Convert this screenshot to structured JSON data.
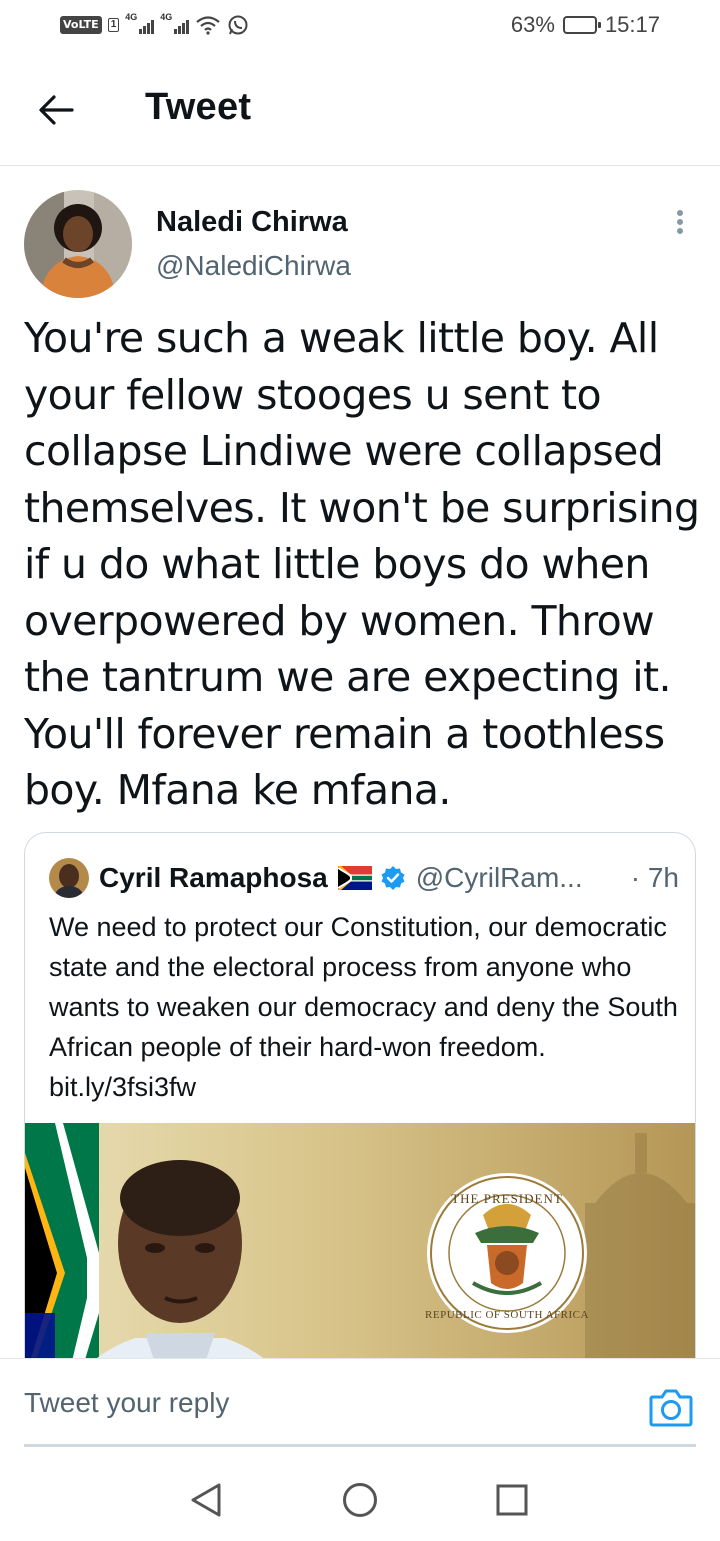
{
  "status_bar": {
    "volte": "VoLTE",
    "sim": "1",
    "network_1": "4G",
    "network_2": "4G",
    "battery_percent": "63%",
    "battery_level": 0.63,
    "time": "15:17"
  },
  "header": {
    "back_icon": "arrow-left-icon",
    "title": "Tweet"
  },
  "tweet": {
    "author_name": "Naledi Chirwa",
    "author_handle": "@NalediChirwa",
    "text": "You're such a weak little boy. All your fellow stooges u sent to collapse Lindiwe were collapsed themselves. It won't be surprising if u do what little boys do when overpowered by women. Throw the tantrum we are expecting it. You'll forever remain a toothless boy. Mfana ke mfana."
  },
  "quote": {
    "author_name": "Cyril Ramaphosa",
    "flag_icon": "south-africa-flag-icon",
    "verified_icon": "verified-badge-icon",
    "author_handle": "@CyrilRam...",
    "time": "· 7h",
    "text": "We need to protect our Constitution, our democratic state and the electoral process from anyone who wants to weaken our democracy and deny the South African people of their hard-won freedom. bit.ly/3fsi3fw",
    "seal_top": "THE PRESIDENT",
    "seal_bottom": "REPUBLIC OF SOUTH AFRICA"
  },
  "reply": {
    "placeholder": "Tweet your reply",
    "camera_icon": "camera-icon"
  },
  "nav": {
    "back_icon": "nav-back-icon",
    "home_icon": "nav-home-icon",
    "recents_icon": "nav-recents-icon"
  },
  "colors": {
    "text_primary": "#0f1419",
    "text_secondary": "#536471",
    "accent": "#1d9bf0",
    "border": "#cfd9de"
  }
}
